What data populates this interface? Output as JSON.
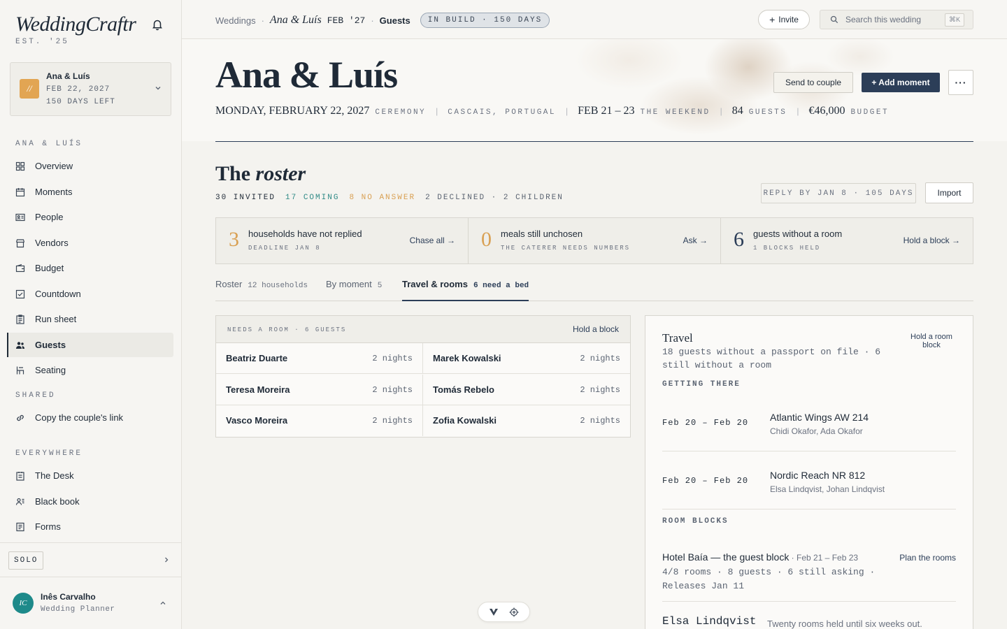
{
  "brand": {
    "name": "WeddingCraftr",
    "est": "EST. '25"
  },
  "wedding_card": {
    "badge": "//",
    "name": "Ana & Luís",
    "date": "FEB 22, 2027",
    "days_left": "150 DAYS LEFT"
  },
  "sidebar": {
    "section_couple": "ANA & LUÍS",
    "items": [
      {
        "label": "Overview",
        "icon": "grid-icon"
      },
      {
        "label": "Moments",
        "icon": "calendar-icon"
      },
      {
        "label": "People",
        "icon": "id-card-icon"
      },
      {
        "label": "Vendors",
        "icon": "store-icon"
      },
      {
        "label": "Budget",
        "icon": "wallet-icon"
      },
      {
        "label": "Countdown",
        "icon": "checkbox-icon"
      },
      {
        "label": "Run sheet",
        "icon": "clipboard-icon"
      },
      {
        "label": "Guests",
        "icon": "users-icon",
        "active": true
      },
      {
        "label": "Seating",
        "icon": "chair-icon"
      }
    ],
    "section_shared": "SHARED",
    "shared_items": [
      {
        "label": "Copy the couple's link",
        "icon": "link-icon"
      }
    ],
    "section_everywhere": "EVERYWHERE",
    "everywhere_items": [
      {
        "label": "The Desk",
        "icon": "desk-icon"
      },
      {
        "label": "Black book",
        "icon": "contacts-icon"
      },
      {
        "label": "Forms",
        "icon": "form-icon"
      }
    ],
    "plan_badge": "SOLO",
    "user": {
      "initials": "IC",
      "name": "Inês Carvalho",
      "role": "Wedding Planner",
      "avatar_color": "#1e8a8a"
    }
  },
  "topbar": {
    "crumb_root": "Weddings",
    "crumb_couple": "Ana & Luís",
    "crumb_date": "FEB '27",
    "crumb_current": "Guests",
    "status": "IN BUILD · 150 DAYS",
    "invite_label": "Invite",
    "search_placeholder": "Search this wedding",
    "search_shortcut": "⌘K"
  },
  "hero": {
    "title": "Ana & Luís",
    "date": "MONDAY, FEBRUARY 22, 2027",
    "date_label": "CEREMONY",
    "location": "CASCAIS, PORTUGAL",
    "weekend": "FEB 21 – 23",
    "weekend_label": "THE WEEKEND",
    "guests": "84",
    "guests_label": "GUESTS",
    "budget": "€46,000",
    "budget_label": "BUDGET",
    "send_label": "Send to couple",
    "add_label": "+ Add moment",
    "more_label": "···"
  },
  "roster": {
    "title_plain": "The ",
    "title_italic": "roster",
    "stats": {
      "invited": "30 INVITED",
      "coming": "17 COMING",
      "no_answer": "8 NO ANSWER",
      "declined": "2 DECLINED · 2 CHILDREN"
    },
    "reply_by": "REPLY BY JAN 8 · 105 DAYS",
    "import_label": "Import",
    "alerts": [
      {
        "num": "3",
        "title": "households have not replied",
        "sub": "DEADLINE JAN 8",
        "link": "Chase all →"
      },
      {
        "num": "0",
        "title": "meals still unchosen",
        "sub": "THE CATERER NEEDS NUMBERS",
        "link": "Ask →"
      },
      {
        "num": "6",
        "title": "guests without a room",
        "sub": "1 BLOCKS HELD",
        "link": "Hold a block →"
      }
    ],
    "tabs": [
      {
        "label": "Roster",
        "count": "12 households"
      },
      {
        "label": "By moment",
        "count": "5"
      },
      {
        "label": "Travel & rooms",
        "count": "6 need a bed",
        "active": true
      }
    ]
  },
  "needs_room": {
    "label": "NEEDS A ROOM · 6 GUESTS",
    "hold_label": "Hold a block",
    "guests": [
      {
        "name": "Beatriz Duarte",
        "nights": "2 nights"
      },
      {
        "name": "Marek Kowalski",
        "nights": "2 nights"
      },
      {
        "name": "Teresa Moreira",
        "nights": "2 nights"
      },
      {
        "name": "Tomás Rebelo",
        "nights": "2 nights"
      },
      {
        "name": "Vasco Moreira",
        "nights": "2 nights"
      },
      {
        "name": "Zofia Kowalski",
        "nights": "2 nights"
      }
    ]
  },
  "travel": {
    "title": "Travel",
    "subtitle": "18 guests without a passport on file · 6 still without a room",
    "hold_label": "Hold a room block",
    "getting_there": "GETTING THERE",
    "flights": [
      {
        "dates": "Feb 20 – Feb 20",
        "name": "Atlantic Wings AW 214",
        "people": "Chidi Okafor, Ada Okafor"
      },
      {
        "dates": "Feb 20 – Feb 20",
        "name": "Nordic Reach NR 812",
        "people": "Elsa Lindqvist, Johan Lindqvist"
      }
    ],
    "room_blocks": "ROOM BLOCKS",
    "block": {
      "name": "Hotel Baía — the guest block",
      "dates": " · Feb 21 – Feb 23",
      "stats": "4/8 rooms · 8 guests · 6 still asking · Releases Jan 11",
      "plan_label": "Plan the rooms"
    },
    "note": {
      "name": "Elsa Lindqvist",
      "text": "Twenty rooms held until six weeks out."
    }
  }
}
